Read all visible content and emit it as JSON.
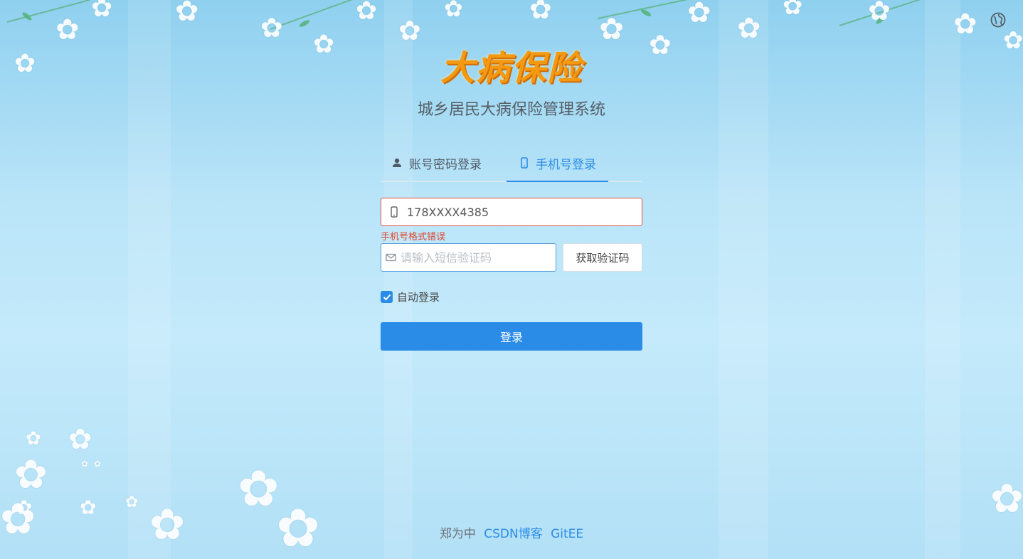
{
  "header": {
    "logo_text": "大病保险",
    "subtitle": "城乡居民大病保险管理系统",
    "language_icon": "globe-icon"
  },
  "tabs": [
    {
      "label": "账号密码登录",
      "icon": "user-icon",
      "active": false
    },
    {
      "label": "手机号登录",
      "icon": "mobile-icon",
      "active": true
    }
  ],
  "form": {
    "phone_value": "178XXXX4385",
    "phone_error": "手机号格式错误",
    "code_placeholder": "请输入短信验证码",
    "get_code_label": "获取验证码",
    "auto_login_label": "自动登录",
    "auto_login_checked": true,
    "submit_label": "登录"
  },
  "footer": {
    "author": "郑为中",
    "links": [
      "CSDN博客",
      "GitEE"
    ]
  },
  "colors": {
    "accent": "#2b8ce8",
    "error": "#e0452e",
    "logo": "#f39a12"
  }
}
